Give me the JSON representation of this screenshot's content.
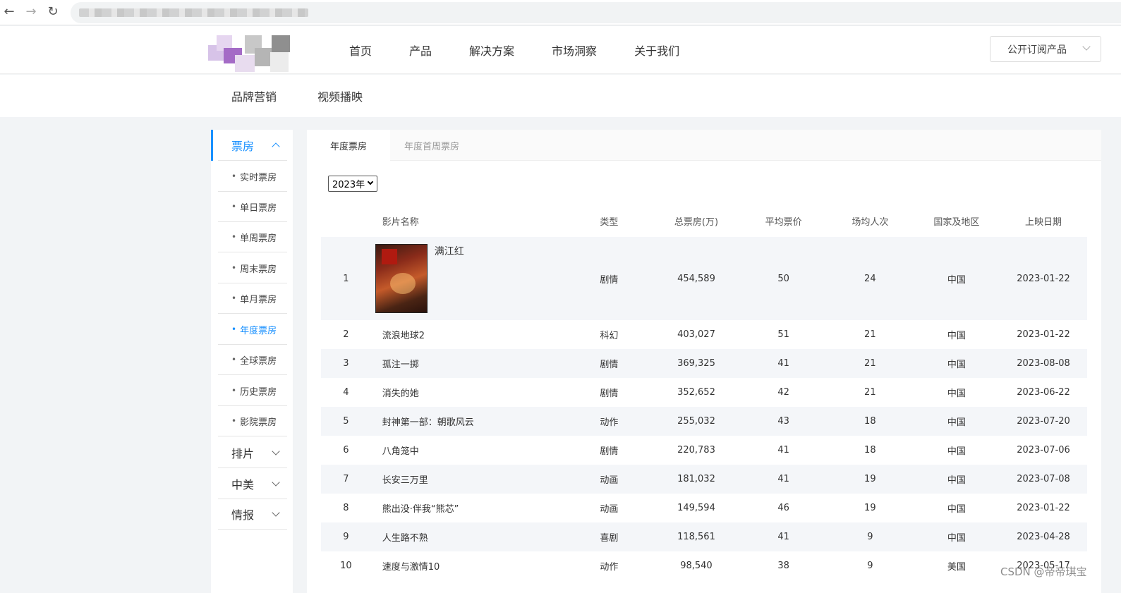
{
  "browser": {
    "back": "←",
    "forward": "→",
    "reload": "↻"
  },
  "nav": {
    "menu": [
      "首页",
      "产品",
      "解决方案",
      "市场洞察",
      "关于我们"
    ],
    "subscribe": "公开订阅产品"
  },
  "subnav": [
    "品牌营销",
    "视频播映"
  ],
  "sidebar": {
    "groups": [
      {
        "label": "票房",
        "expanded": true
      },
      {
        "label": "排片",
        "expanded": false
      },
      {
        "label": "中美",
        "expanded": false
      },
      {
        "label": "情报",
        "expanded": false
      }
    ],
    "items": [
      "实时票房",
      "单日票房",
      "单周票房",
      "周末票房",
      "单月票房",
      "年度票房",
      "全球票房",
      "历史票房",
      "影院票房"
    ],
    "active_item": "年度票房"
  },
  "tabs": [
    "年度票房",
    "年度首周票房"
  ],
  "year_select": "2023年",
  "table": {
    "headers": [
      "",
      "影片名称",
      "类型",
      "总票房(万)",
      "平均票价",
      "场均人次",
      "国家及地区",
      "上映日期"
    ],
    "rows": [
      [
        "1",
        "满江红",
        "剧情",
        "454,589",
        "50",
        "24",
        "中国",
        "2023-01-22"
      ],
      [
        "2",
        "流浪地球2",
        "科幻",
        "403,027",
        "51",
        "21",
        "中国",
        "2023-01-22"
      ],
      [
        "3",
        "孤注一掷",
        "剧情",
        "369,325",
        "41",
        "21",
        "中国",
        "2023-08-08"
      ],
      [
        "4",
        "消失的她",
        "剧情",
        "352,652",
        "42",
        "21",
        "中国",
        "2023-06-22"
      ],
      [
        "5",
        "封神第一部：朝歌风云",
        "动作",
        "255,032",
        "43",
        "18",
        "中国",
        "2023-07-20"
      ],
      [
        "6",
        "八角笼中",
        "剧情",
        "220,783",
        "41",
        "18",
        "中国",
        "2023-07-06"
      ],
      [
        "7",
        "长安三万里",
        "动画",
        "181,032",
        "41",
        "19",
        "中国",
        "2023-07-08"
      ],
      [
        "8",
        "熊出没·伴我“熊芯”",
        "动画",
        "149,594",
        "46",
        "19",
        "中国",
        "2023-01-22"
      ],
      [
        "9",
        "人生路不熟",
        "喜剧",
        "118,561",
        "41",
        "9",
        "中国",
        "2023-04-28"
      ],
      [
        "10",
        "速度与激情10",
        "动作",
        "98,540",
        "38",
        "9",
        "美国",
        "2023-05-17"
      ]
    ]
  },
  "watermark": "CSDN @帝帝琪宝"
}
